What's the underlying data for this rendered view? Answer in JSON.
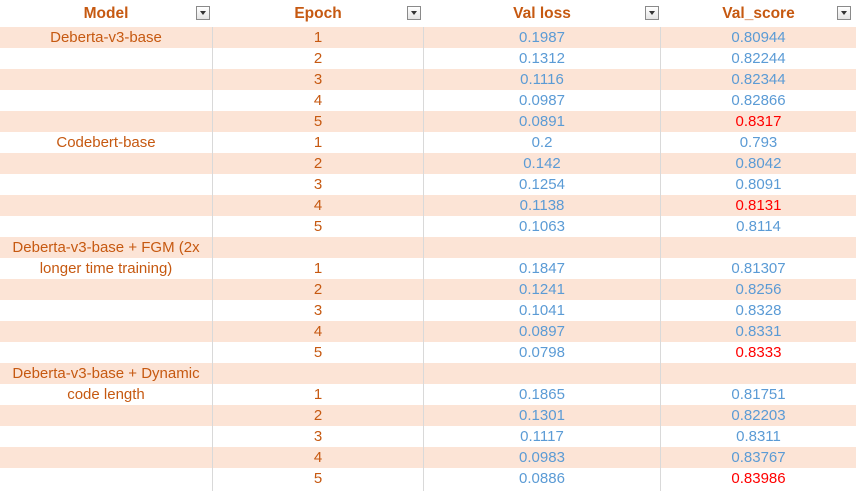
{
  "headers": [
    "Model",
    "Epoch",
    "Val loss",
    "Val_score"
  ],
  "models": [
    {
      "lines": [
        "Deberta-v3-base"
      ],
      "first_row": 0
    },
    {
      "lines": [
        "Codebert-base"
      ],
      "first_row": 5
    },
    {
      "lines": [
        "Deberta-v3-base + FGM (2x",
        "longer time training)"
      ],
      "first_row": 10
    },
    {
      "lines": [
        "Deberta-v3-base + Dynamic",
        "code length"
      ],
      "first_row": 16
    }
  ],
  "rows": [
    {
      "epoch": "1",
      "loss": "0.1987",
      "score": "0.80944",
      "highlight": false
    },
    {
      "epoch": "2",
      "loss": "0.1312",
      "score": "0.82244",
      "highlight": false
    },
    {
      "epoch": "3",
      "loss": "0.1116",
      "score": "0.82344",
      "highlight": false
    },
    {
      "epoch": "4",
      "loss": "0.0987",
      "score": "0.82866",
      "highlight": false
    },
    {
      "epoch": "5",
      "loss": "0.0891",
      "score": "0.8317",
      "highlight": true
    },
    {
      "epoch": "1",
      "loss": "0.2",
      "score": "0.793",
      "highlight": false
    },
    {
      "epoch": "2",
      "loss": "0.142",
      "score": "0.8042",
      "highlight": false
    },
    {
      "epoch": "3",
      "loss": "0.1254",
      "score": "0.8091",
      "highlight": false
    },
    {
      "epoch": "4",
      "loss": "0.1138",
      "score": "0.8131",
      "highlight": true
    },
    {
      "epoch": "5",
      "loss": "0.1063",
      "score": "0.8114",
      "highlight": false
    },
    {
      "epoch": "",
      "loss": "",
      "score": "",
      "highlight": false
    },
    {
      "epoch": "1",
      "loss": "0.1847",
      "score": "0.81307",
      "highlight": false
    },
    {
      "epoch": "2",
      "loss": "0.1241",
      "score": "0.8256",
      "highlight": false
    },
    {
      "epoch": "3",
      "loss": "0.1041",
      "score": "0.8328",
      "highlight": false
    },
    {
      "epoch": "4",
      "loss": "0.0897",
      "score": "0.8331",
      "highlight": false
    },
    {
      "epoch": "5",
      "loss": "0.0798",
      "score": "0.8333",
      "highlight": true
    },
    {
      "epoch": "",
      "loss": "",
      "score": "",
      "highlight": false
    },
    {
      "epoch": "1",
      "loss": "0.1865",
      "score": "0.81751",
      "highlight": false
    },
    {
      "epoch": "2",
      "loss": "0.1301",
      "score": "0.82203",
      "highlight": false
    },
    {
      "epoch": "3",
      "loss": "0.1117",
      "score": "0.8311",
      "highlight": false
    },
    {
      "epoch": "4",
      "loss": "0.0983",
      "score": "0.83767",
      "highlight": false
    },
    {
      "epoch": "5",
      "loss": "0.0886",
      "score": "0.83986",
      "highlight": true
    }
  ],
  "colors": {
    "header_text": "#c65911",
    "band": "#fce4d6",
    "loss_text": "#5b9bd5",
    "score_highlight": "#ff0000"
  }
}
